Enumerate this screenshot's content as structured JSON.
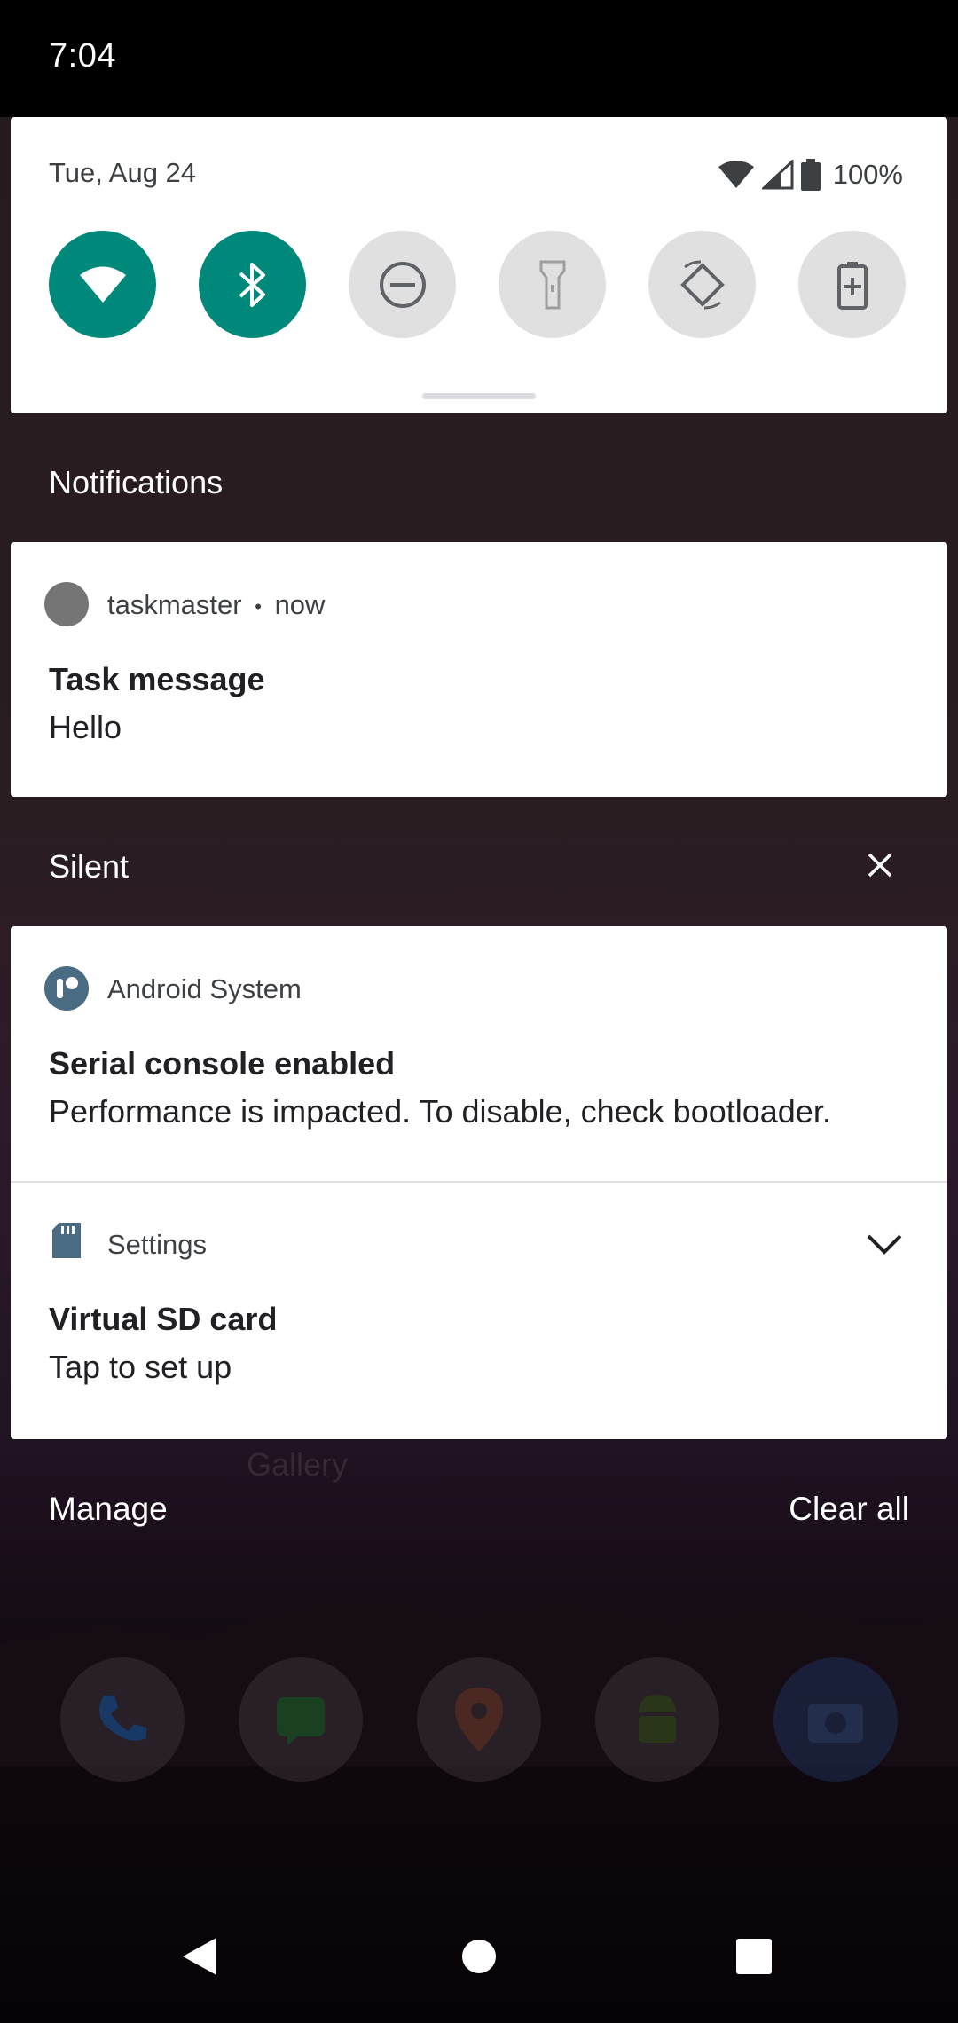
{
  "status_bar": {
    "time": "7:04"
  },
  "quick_settings": {
    "date": "Tue, Aug 24",
    "battery_percent": "100%",
    "tiles": [
      {
        "name": "wifi",
        "state": "on"
      },
      {
        "name": "bluetooth",
        "state": "on"
      },
      {
        "name": "do-not-disturb",
        "state": "off"
      },
      {
        "name": "flashlight",
        "state": "off"
      },
      {
        "name": "auto-rotate",
        "state": "off"
      },
      {
        "name": "battery-saver",
        "state": "off"
      }
    ]
  },
  "notifications_header": "Notifications",
  "task_notification": {
    "app": "taskmaster",
    "separator": "•",
    "time": "now",
    "title": "Task message",
    "text": "Hello"
  },
  "silent_header": "Silent",
  "silent_notifications": [
    {
      "app": "Android System",
      "title": "Serial console enabled",
      "text": "Performance is impacted. To disable, check bootloader."
    },
    {
      "app": "Settings",
      "title": "Virtual SD card",
      "text": "Tap to set up"
    }
  ],
  "footer": {
    "manage": "Manage",
    "clear_all": "Clear all"
  },
  "home_ghost": {
    "label": "Gallery"
  },
  "colors": {
    "accent": "#00897b",
    "tile_off": "#e0e0e0"
  }
}
